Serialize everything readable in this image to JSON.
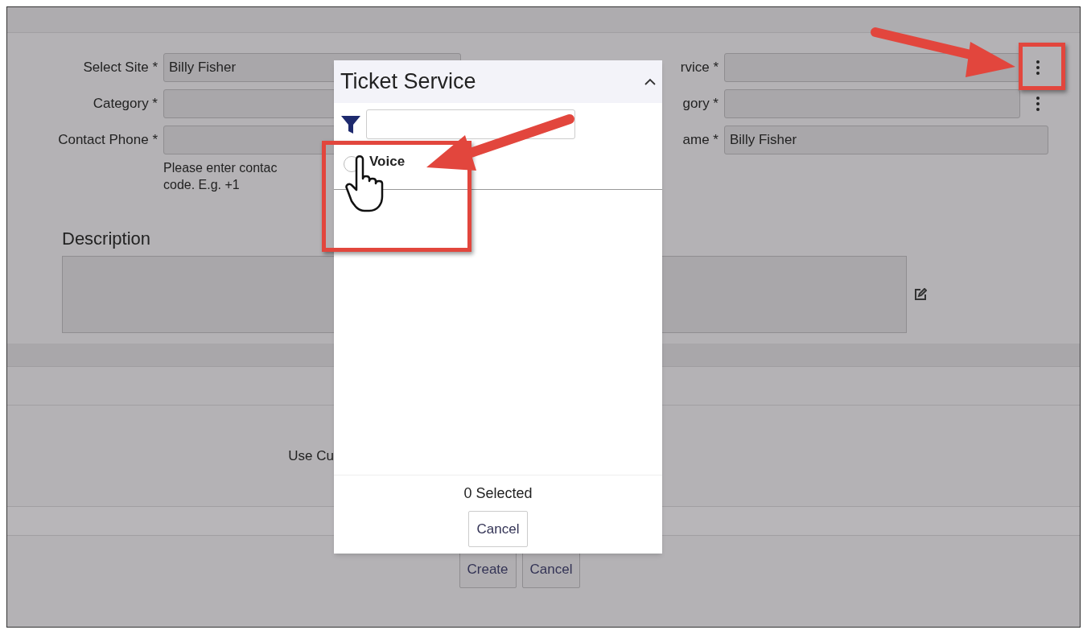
{
  "form": {
    "left_fields": [
      {
        "label": "Select Site *",
        "value": "Billy Fisher"
      },
      {
        "label": "Category *"
      },
      {
        "label": "Contact Phone *"
      }
    ],
    "hint_lines": [
      "Please enter contac",
      "code. E.g. +1"
    ],
    "right_fields": [
      {
        "label": "rvice *",
        "menu": true
      },
      {
        "label": "gory *",
        "menu": true
      },
      {
        "label": "ame *",
        "value": "Billy Fisher",
        "menu": false
      }
    ],
    "description": {
      "heading": "Description"
    },
    "option_label": "Use Cu",
    "buttons": [
      "Create",
      "Cancel"
    ]
  },
  "popup": {
    "title": "Ticket Service",
    "items": [
      {
        "label": "Voice",
        "selected": false
      }
    ],
    "count": "0 Selected",
    "button": "Cancel"
  }
}
